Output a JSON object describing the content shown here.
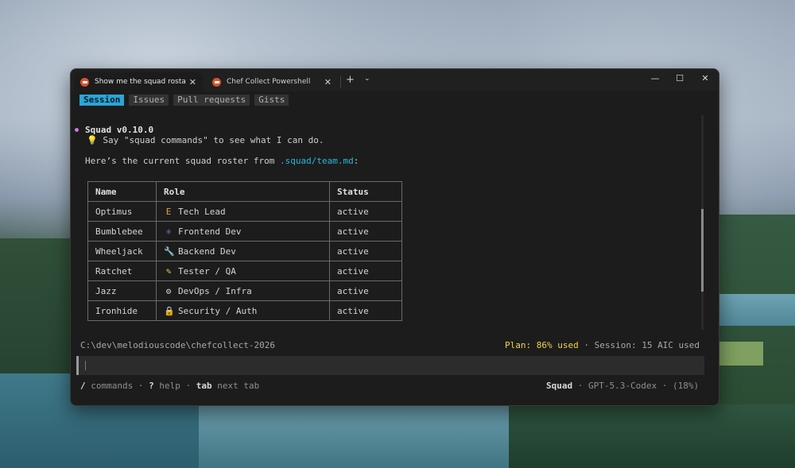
{
  "tabs": [
    {
      "title": "Show me the squad rosta",
      "close": "✕"
    },
    {
      "title": "Chef Collect Powershell",
      "close": "✕"
    }
  ],
  "titlebar": {
    "new_tab": "+",
    "dropdown": "⌄",
    "minimize": "—",
    "maximize": "☐",
    "close": "✕"
  },
  "nav": {
    "session": "Session",
    "issues": "Issues",
    "pull_requests": "Pull requests",
    "gists": "Gists"
  },
  "agent": {
    "name": "Squad v0.10.0",
    "tip_icon": "bulb-icon",
    "tip": " Say \"squad commands\" to see what I can do."
  },
  "intro": {
    "text": "Here’s the current squad roster from ",
    "link": ".squad/team.md",
    "suffix": ":"
  },
  "roster": {
    "headers": {
      "name": "Name",
      "role": "Role",
      "status": "Status"
    },
    "rows": [
      {
        "name": "Optimus",
        "icon": "E",
        "icon_name": "lead-icon",
        "role": "Tech Lead",
        "status": "active"
      },
      {
        "name": "Bumblebee",
        "icon": "⚛",
        "icon_name": "react-icon",
        "role": "Frontend Dev",
        "status": "active"
      },
      {
        "name": "Wheeljack",
        "icon": "🔧",
        "icon_name": "wrench-icon",
        "role": "Backend Dev",
        "status": "active"
      },
      {
        "name": "Ratchet",
        "icon": "✎",
        "icon_name": "pencil-icon",
        "role": "Tester / QA",
        "status": "active"
      },
      {
        "name": "Jazz",
        "icon": "⚙",
        "icon_name": "gear-icon",
        "role": "DevOps / Infra",
        "status": "active"
      },
      {
        "name": "Ironhide",
        "icon": "🔒",
        "icon_name": "lock-icon",
        "role": "Security / Auth",
        "status": "active"
      }
    ]
  },
  "status": {
    "cwd": "C:\\dev\\melodiouscode\\chefcollect-2026",
    "plan": "Plan: 86% used",
    "sep": " · ",
    "session": "Session: 15 AIC used"
  },
  "footer": {
    "slash": "/",
    "commands": " commands",
    "dot1": " · ",
    "q": "?",
    "help": " help",
    "dot2": " · ",
    "tab": "tab",
    "next_tab": " next tab",
    "agent": "Squad",
    "dot3": " · ",
    "model": "GPT-5.3-Codex",
    "dot4": " · ",
    "usage": "(18%)"
  },
  "colors": {
    "accent": "#2aa6d6",
    "link": "#29b8db",
    "plan": "#f2d24b",
    "agent_dot": "#c679dd"
  }
}
